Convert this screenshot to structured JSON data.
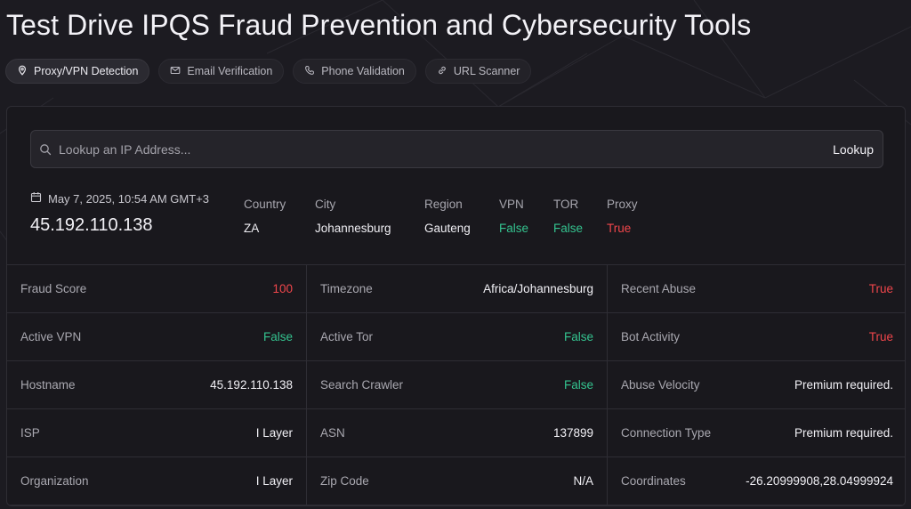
{
  "page": {
    "title": "Test Drive IPQS Fraud Prevention and Cybersecurity Tools"
  },
  "tabs": [
    {
      "label": "Proxy/VPN Detection",
      "icon": "map-pin-icon",
      "active": true
    },
    {
      "label": "Email Verification",
      "icon": "mail-icon",
      "active": false
    },
    {
      "label": "Phone Validation",
      "icon": "phone-icon",
      "active": false
    },
    {
      "label": "URL Scanner",
      "icon": "link-icon",
      "active": false
    }
  ],
  "search": {
    "placeholder": "Lookup an IP Address...",
    "button_label": "Lookup"
  },
  "summary": {
    "timestamp": "May 7, 2025, 10:54 AM GMT+3",
    "ip": "45.192.110.138",
    "country_label": "Country",
    "country": "ZA",
    "city_label": "City",
    "city": "Johannesburg",
    "region_label": "Region",
    "region": "Gauteng",
    "vpn_label": "VPN",
    "vpn": "False",
    "tor_label": "TOR",
    "tor": "False",
    "proxy_label": "Proxy",
    "proxy": "True"
  },
  "details": [
    {
      "label": "Fraud Score",
      "value": "100",
      "status": "bad"
    },
    {
      "label": "Timezone",
      "value": "Africa/Johannesburg",
      "status": "neutral"
    },
    {
      "label": "Recent Abuse",
      "value": "True",
      "status": "bad"
    },
    {
      "label": "Active VPN",
      "value": "False",
      "status": "good"
    },
    {
      "label": "Active Tor",
      "value": "False",
      "status": "good"
    },
    {
      "label": "Bot Activity",
      "value": "True",
      "status": "bad"
    },
    {
      "label": "Hostname",
      "value": "45.192.110.138",
      "status": "neutral"
    },
    {
      "label": "Search Crawler",
      "value": "False",
      "status": "good"
    },
    {
      "label": "Abuse Velocity",
      "value": "Premium required.",
      "status": "neutral"
    },
    {
      "label": "ISP",
      "value": "I Layer",
      "status": "neutral"
    },
    {
      "label": "ASN",
      "value": "137899",
      "status": "neutral"
    },
    {
      "label": "Connection Type",
      "value": "Premium required.",
      "status": "neutral"
    },
    {
      "label": "Organization",
      "value": "I Layer",
      "status": "neutral"
    },
    {
      "label": "Zip Code",
      "value": "N/A",
      "status": "neutral"
    },
    {
      "label": "Coordinates",
      "value": "-26.20999908,28.04999924",
      "status": "neutral"
    }
  ],
  "colors": {
    "background": "#1c1b21",
    "good": "#34c38f",
    "bad": "#f0464b"
  }
}
